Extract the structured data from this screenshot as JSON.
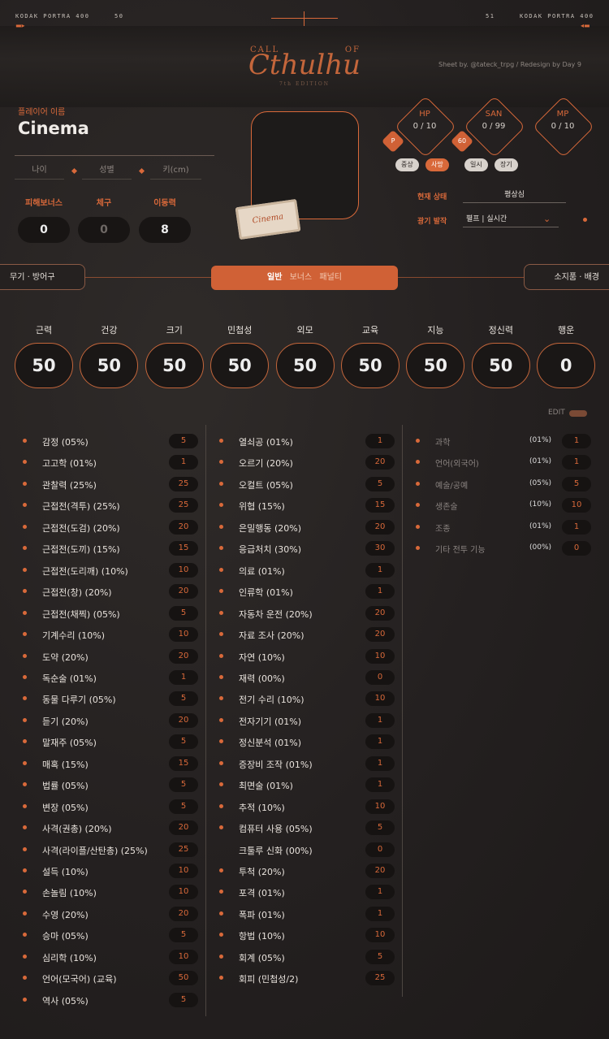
{
  "header": {
    "film_left": "KODAK PORTRA 400",
    "num_left": "50",
    "num_right": "51",
    "film_right": "KODAK PORTRA 400",
    "logo_top_left": "CALL",
    "logo_top_right": "OF",
    "logo_main": "Cthulhu",
    "logo_sub": "7th EDITION",
    "credit": "Sheet by. @tateck_trpg / Redesign by Day 9"
  },
  "player": {
    "label": "플레이어 이름",
    "name": "Cinema",
    "fields": [
      "나이",
      "성별",
      "키(cm)"
    ],
    "stats": [
      {
        "label": "피해보너스",
        "value": "0"
      },
      {
        "label": "체구",
        "value": "0"
      },
      {
        "label": "이동력",
        "value": "8"
      }
    ],
    "ticket_text": "Cinema"
  },
  "status": {
    "hp": {
      "label": "HP",
      "value": "0 / 10"
    },
    "san": {
      "label": "SAN",
      "value": "0 / 99"
    },
    "mp": {
      "label": "MP",
      "value": "0 / 10"
    },
    "p_badge": "P",
    "num_badge": "60",
    "chips": [
      {
        "label": "중상",
        "active": false
      },
      {
        "label": "사망",
        "active": true
      },
      {
        "label": "일시",
        "active": false
      },
      {
        "label": "장기",
        "active": false
      }
    ],
    "current_label": "현재 상태",
    "current_value": "평상심",
    "madness_label": "광기 발작",
    "madness_value": "펼프 | 실시간"
  },
  "tabs": {
    "left": "무기 · 방어구",
    "main": [
      "일반",
      "보너스",
      "패널티"
    ],
    "right": "소지품 · 배경"
  },
  "characteristics": [
    {
      "name": "근력",
      "value": "50"
    },
    {
      "name": "건강",
      "value": "50"
    },
    {
      "name": "크기",
      "value": "50"
    },
    {
      "name": "민첩성",
      "value": "50"
    },
    {
      "name": "외모",
      "value": "50"
    },
    {
      "name": "교육",
      "value": "50"
    },
    {
      "name": "지능",
      "value": "50"
    },
    {
      "name": "정신력",
      "value": "50"
    },
    {
      "name": "행운",
      "value": "0"
    }
  ],
  "edit_label": "EDIT",
  "skills_col1": [
    {
      "name": "감정 (05%)",
      "value": "5"
    },
    {
      "name": "고고학 (01%)",
      "value": "1"
    },
    {
      "name": "관찰력 (25%)",
      "value": "25"
    },
    {
      "name": "근접전(격투) (25%)",
      "value": "25"
    },
    {
      "name": "근접전(도검) (20%)",
      "value": "20"
    },
    {
      "name": "근접전(도끼) (15%)",
      "value": "15"
    },
    {
      "name": "근접전(도리깨) (10%)",
      "value": "10"
    },
    {
      "name": "근접전(창) (20%)",
      "value": "20"
    },
    {
      "name": "근접전(채찍) (05%)",
      "value": "5"
    },
    {
      "name": "기계수리 (10%)",
      "value": "10"
    },
    {
      "name": "도약 (20%)",
      "value": "20"
    },
    {
      "name": "독순술 (01%)",
      "value": "1"
    },
    {
      "name": "동물 다루기 (05%)",
      "value": "5"
    },
    {
      "name": "듣기 (20%)",
      "value": "20"
    },
    {
      "name": "말재주 (05%)",
      "value": "5"
    },
    {
      "name": "매혹 (15%)",
      "value": "15"
    },
    {
      "name": "법률 (05%)",
      "value": "5"
    },
    {
      "name": "변장 (05%)",
      "value": "5"
    },
    {
      "name": "사격(권총) (20%)",
      "value": "20"
    },
    {
      "name": "사격(라이플/산탄총) (25%)",
      "value": "25"
    },
    {
      "name": "설득 (10%)",
      "value": "10"
    },
    {
      "name": "손놀림 (10%)",
      "value": "10"
    },
    {
      "name": "수영 (20%)",
      "value": "20"
    },
    {
      "name": "승마 (05%)",
      "value": "5"
    },
    {
      "name": "심리학 (10%)",
      "value": "10"
    },
    {
      "name": "언어(모국어) (교육)",
      "value": "50"
    },
    {
      "name": "역사 (05%)",
      "value": "5"
    }
  ],
  "skills_col2": [
    {
      "name": "열쇠공 (01%)",
      "value": "1",
      "dot": true
    },
    {
      "name": "오르기 (20%)",
      "value": "20",
      "dot": true
    },
    {
      "name": "오컬트 (05%)",
      "value": "5",
      "dot": true
    },
    {
      "name": "위협 (15%)",
      "value": "15",
      "dot": true
    },
    {
      "name": "은밀행동 (20%)",
      "value": "20",
      "dot": true
    },
    {
      "name": "응급처치 (30%)",
      "value": "30",
      "dot": true
    },
    {
      "name": "의료 (01%)",
      "value": "1",
      "dot": true
    },
    {
      "name": "인류학 (01%)",
      "value": "1",
      "dot": true
    },
    {
      "name": "자동차 운전 (20%)",
      "value": "20",
      "dot": true
    },
    {
      "name": "자료 조사 (20%)",
      "value": "20",
      "dot": true
    },
    {
      "name": "자연 (10%)",
      "value": "10",
      "dot": true
    },
    {
      "name": "재력 (00%)",
      "value": "0",
      "dot": true
    },
    {
      "name": "전기 수리 (10%)",
      "value": "10",
      "dot": true
    },
    {
      "name": "전자기기 (01%)",
      "value": "1",
      "dot": true
    },
    {
      "name": "정신분석 (01%)",
      "value": "1",
      "dot": true
    },
    {
      "name": "증장비 조작 (01%)",
      "value": "1",
      "dot": true
    },
    {
      "name": "최면술 (01%)",
      "value": "1",
      "dot": true
    },
    {
      "name": "추적 (10%)",
      "value": "10",
      "dot": true
    },
    {
      "name": "컴퓨터 사용 (05%)",
      "value": "5",
      "dot": true
    },
    {
      "name": "크툴루 신화 (00%)",
      "value": "0",
      "dot": false
    },
    {
      "name": "투척 (20%)",
      "value": "20",
      "dot": true
    },
    {
      "name": "포격 (01%)",
      "value": "1",
      "dot": true
    },
    {
      "name": "폭파 (01%)",
      "value": "1",
      "dot": true
    },
    {
      "name": "항법 (10%)",
      "value": "10",
      "dot": true
    },
    {
      "name": "회계 (05%)",
      "value": "5",
      "dot": true
    },
    {
      "name": "회피 (민첩성/2)",
      "value": "25",
      "dot": true
    }
  ],
  "skills_col3": [
    {
      "name": "과학",
      "pct": "(01%)",
      "value": "1"
    },
    {
      "name": "언어(외국어)",
      "pct": "(01%)",
      "value": "1"
    },
    {
      "name": "예술/공예",
      "pct": "(05%)",
      "value": "5"
    },
    {
      "name": "생존술",
      "pct": "(10%)",
      "value": "10"
    },
    {
      "name": "조종",
      "pct": "(01%)",
      "value": "1"
    },
    {
      "name": "기타 전투 기능",
      "pct": "(00%)",
      "value": "0"
    }
  ]
}
